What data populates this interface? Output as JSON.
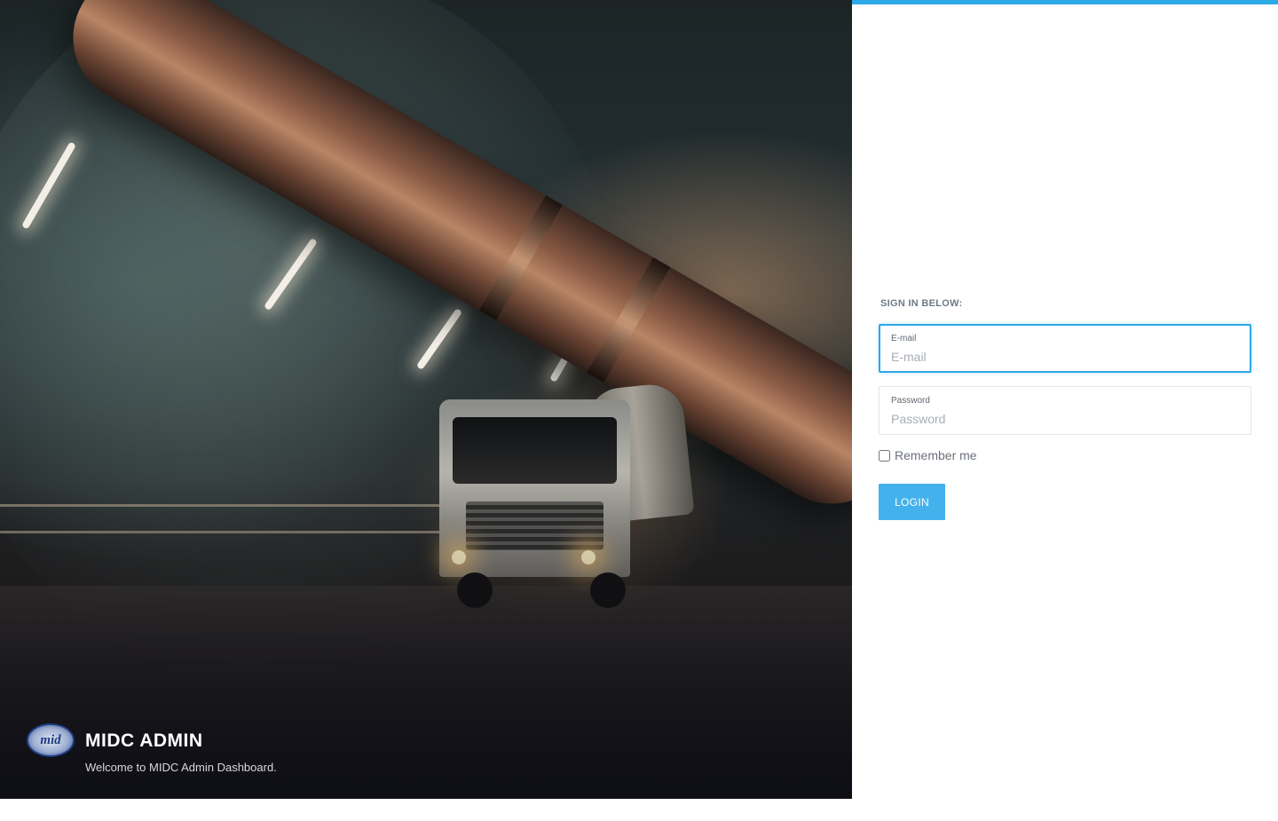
{
  "brand": {
    "logo_text": "mid",
    "title": "MIDC ADMIN",
    "subtitle": "Welcome to MIDC Admin Dashboard."
  },
  "login": {
    "heading": "SIGN IN BELOW:",
    "email": {
      "label": "E-mail",
      "placeholder": "E-mail",
      "value": ""
    },
    "password": {
      "label": "Password",
      "placeholder": "Password",
      "value": ""
    },
    "remember_label": "Remember me",
    "remember_checked": false,
    "submit_label": "LOGIN"
  },
  "colors": {
    "accent": "#2ca9e6",
    "button": "#43b2ec"
  }
}
